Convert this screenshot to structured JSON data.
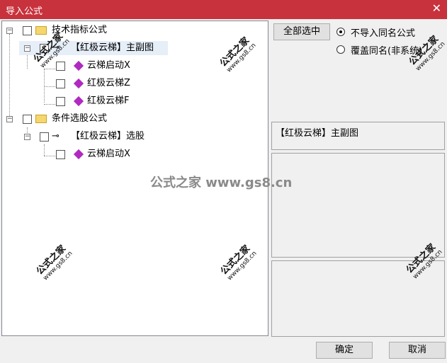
{
  "window": {
    "title": "导入公式",
    "close_glyph": "✕"
  },
  "tree": {
    "groups": [
      {
        "label": "技术指标公式",
        "child": "【红极云梯】主副图",
        "items": [
          "云梯启动X",
          "红极云梯Z",
          "红极云梯F"
        ]
      },
      {
        "label": "条件选股公式",
        "child": "【红极云梯】选股",
        "items": [
          "云梯启动X"
        ]
      }
    ]
  },
  "actions": {
    "select_all": "全部选中",
    "ok": "确定",
    "cancel": "取消"
  },
  "options": {
    "skip_same_name": "不导入同名公式",
    "overwrite_same_name": "覆盖同名(非系统)",
    "selected": "skip_same_name"
  },
  "detail": {
    "name": "【红极云梯】主副图"
  },
  "watermark": {
    "brand": "公式之家",
    "site": "www.gs8.cn",
    "center": "公式之家 www.gs8.cn"
  },
  "colors": {
    "titlebar": "#c8323c",
    "gem": "#b02ac0",
    "folder": "#f5d76e"
  }
}
